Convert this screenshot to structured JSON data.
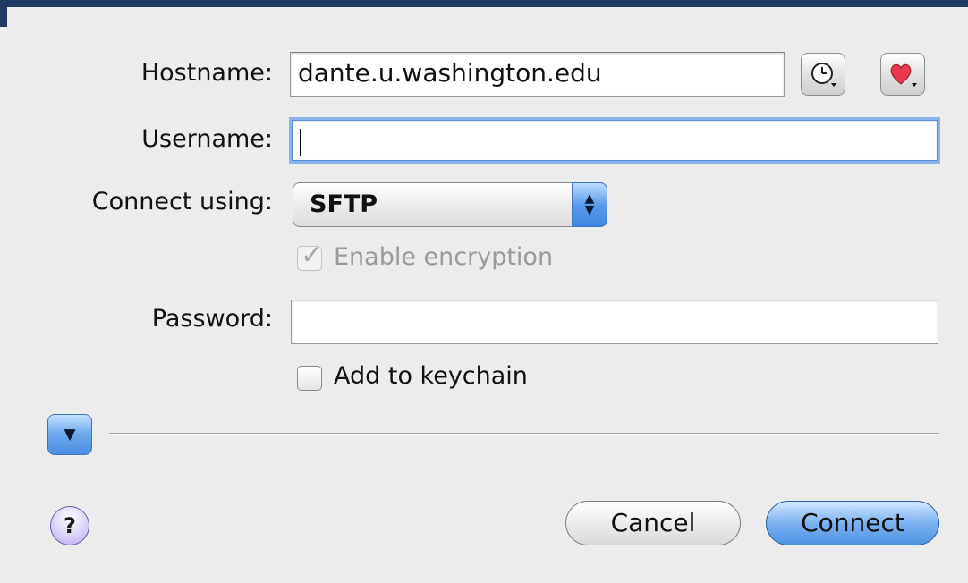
{
  "form": {
    "hostname_label": "Hostname:",
    "hostname_value": "dante.u.washington.edu",
    "username_label": "Username:",
    "username_value": "",
    "connect_using_label": "Connect using:",
    "connect_using_value": "SFTP",
    "enable_encryption_label": "Enable encryption",
    "enable_encryption_checked": true,
    "enable_encryption_enabled": false,
    "password_label": "Password:",
    "password_value": "",
    "add_keychain_label": "Add to keychain",
    "add_keychain_checked": false
  },
  "icons": {
    "history": "clock-icon",
    "favorites": "heart-icon",
    "help": "?"
  },
  "buttons": {
    "cancel": "Cancel",
    "connect": "Connect"
  },
  "colors": {
    "accent": "#4f94e4",
    "window_bg": "#ececec",
    "title_bar": "#1f3b5f"
  }
}
